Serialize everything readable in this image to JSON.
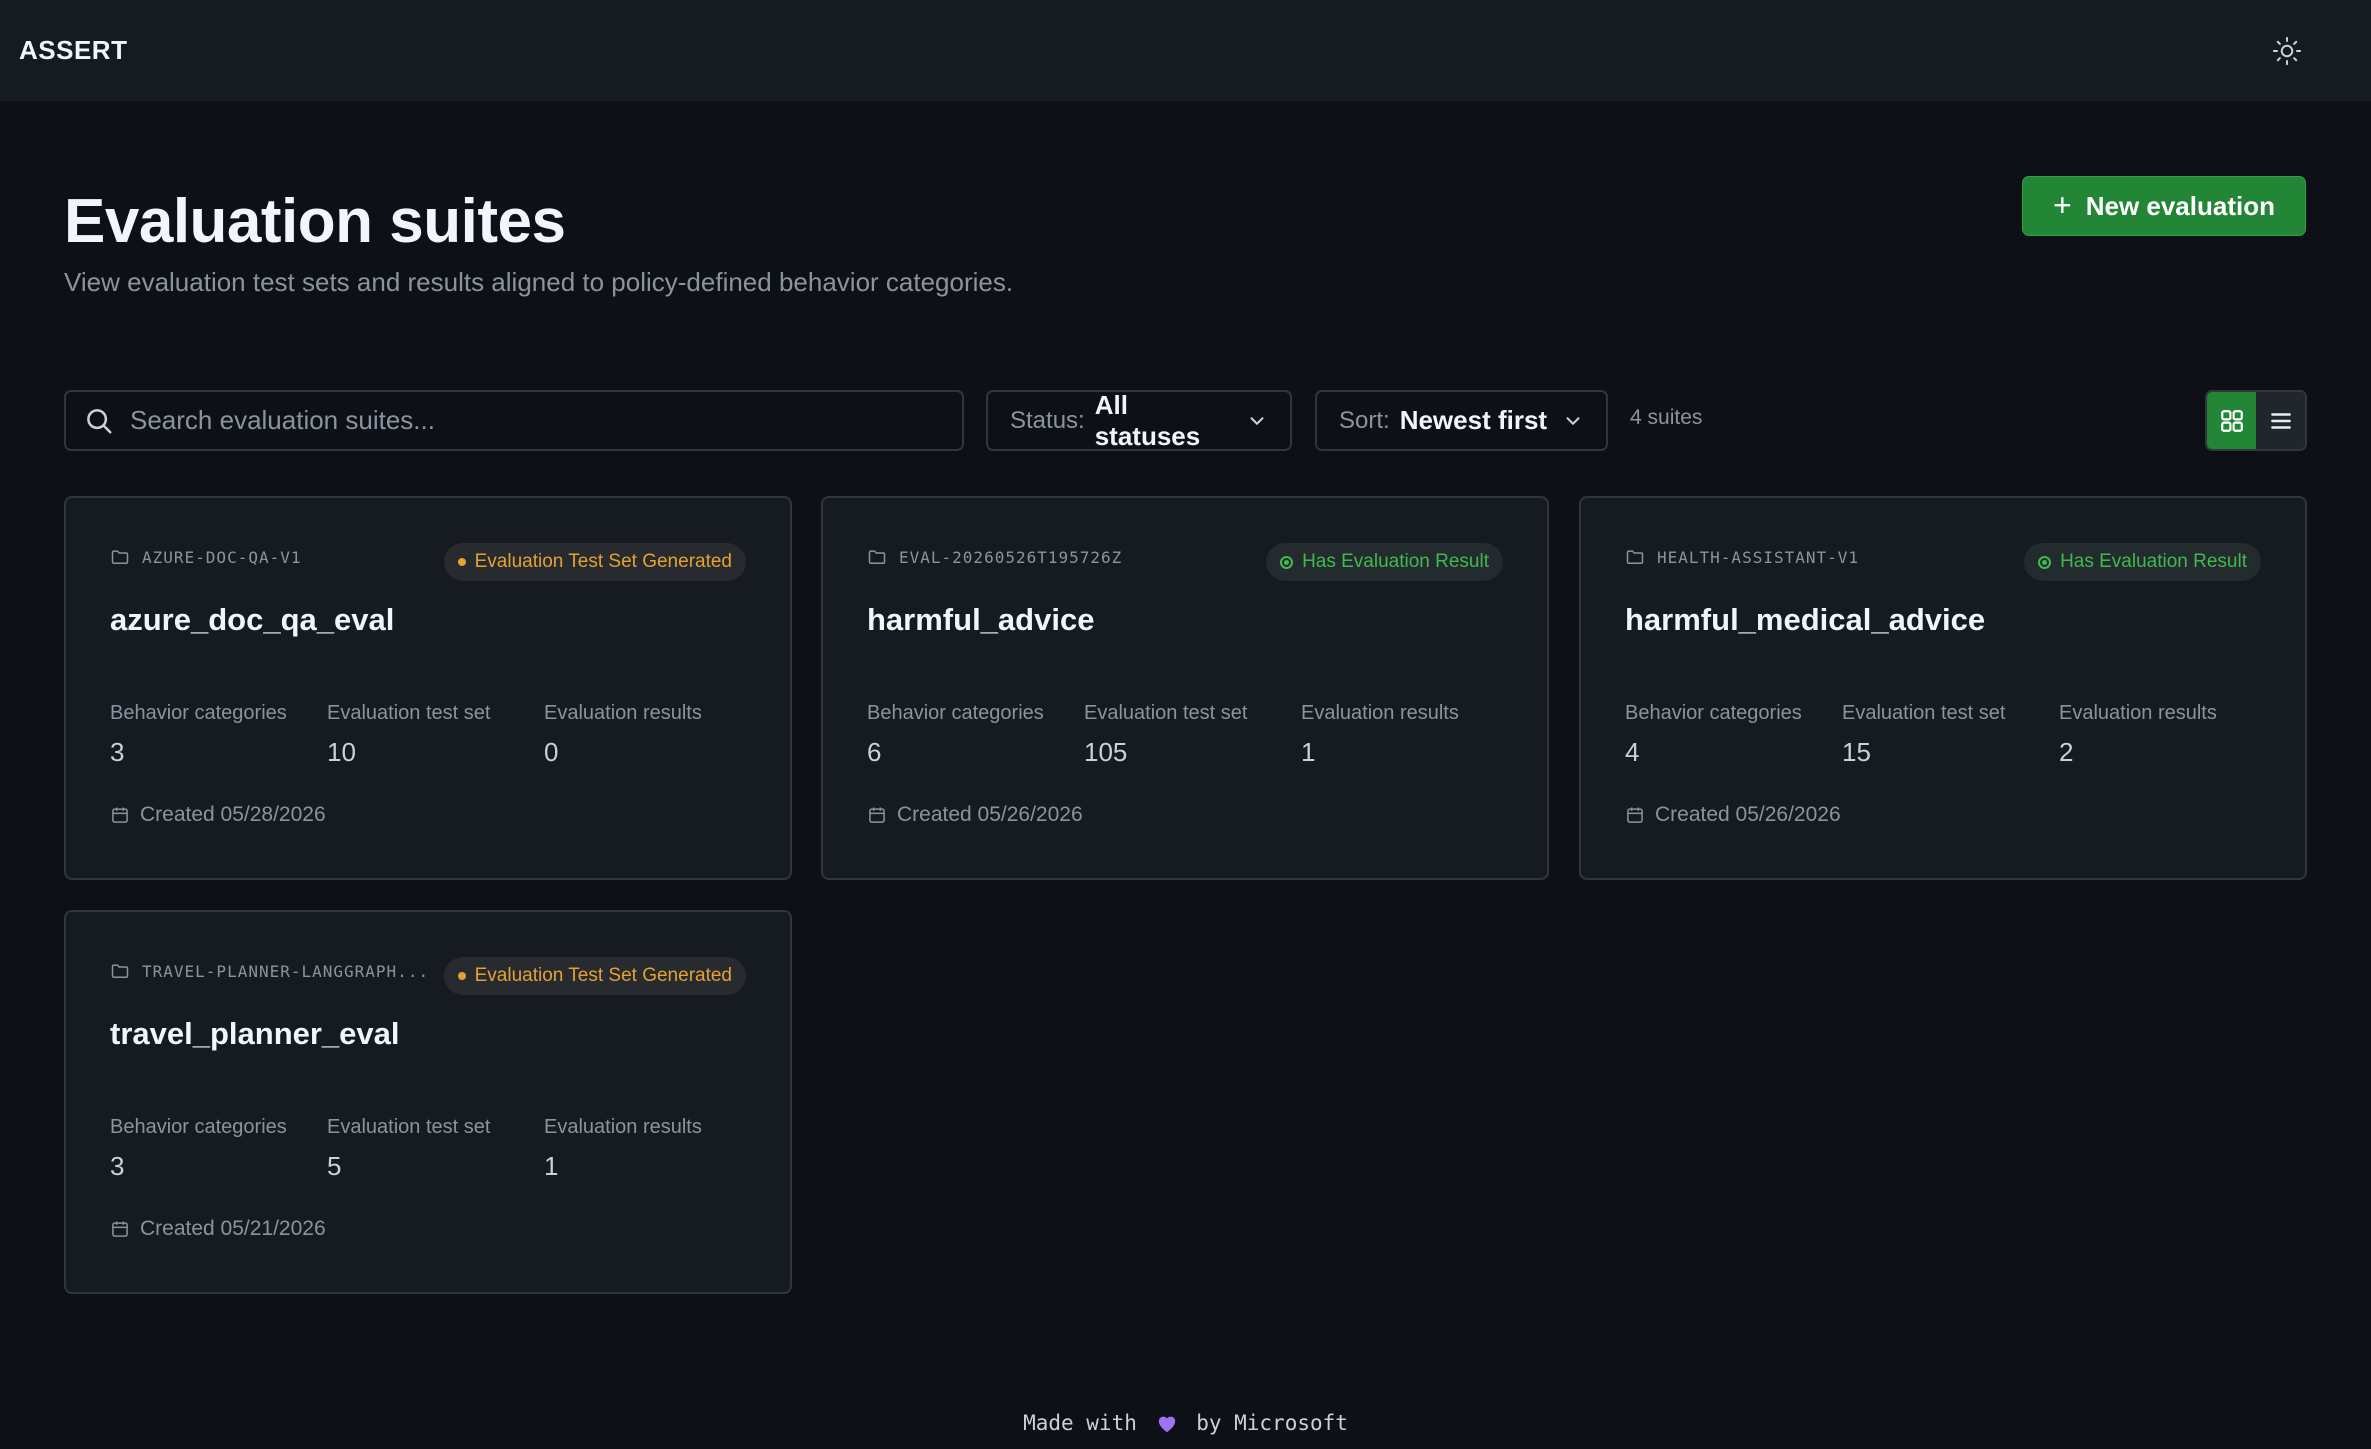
{
  "app": {
    "brand": "ASSERT"
  },
  "header": {
    "title": "Evaluation suites",
    "subtitle": "View evaluation test sets and results aligned to policy-defined behavior categories.",
    "new_button_label": "New evaluation"
  },
  "toolbar": {
    "search_placeholder": "Search evaluation suites...",
    "status_label": "Status:",
    "status_value": "All statuses",
    "sort_label": "Sort:",
    "sort_value": "Newest first",
    "count_text": "4 suites",
    "active_view": "grid"
  },
  "stat_labels": {
    "behavior": "Behavior categories",
    "test_set": "Evaluation test set",
    "results": "Evaluation results"
  },
  "cards": [
    {
      "id": "AZURE-DOC-QA-V1",
      "status": "Evaluation Test Set Generated",
      "status_kind": "generated",
      "name": "azure_doc_qa_eval",
      "behavior_categories": "3",
      "test_set": "10",
      "results": "0",
      "created": "Created 05/28/2026"
    },
    {
      "id": "EVAL-20260526T195726Z",
      "status": "Has Evaluation Result",
      "status_kind": "result",
      "name": "harmful_advice",
      "behavior_categories": "6",
      "test_set": "105",
      "results": "1",
      "created": "Created 05/26/2026"
    },
    {
      "id": "HEALTH-ASSISTANT-V1",
      "status": "Has Evaluation Result",
      "status_kind": "result",
      "name": "harmful_medical_advice",
      "behavior_categories": "4",
      "test_set": "15",
      "results": "2",
      "created": "Created 05/26/2026"
    },
    {
      "id": "TRAVEL-PLANNER-LANGGRAPH...",
      "status": "Evaluation Test Set Generated",
      "status_kind": "generated",
      "name": "travel_planner_eval",
      "behavior_categories": "3",
      "test_set": "5",
      "results": "1",
      "created": "Created 05/21/2026"
    }
  ],
  "footer": {
    "prefix": "Made with",
    "heart_icon": "purple-heart",
    "suffix": "by Microsoft"
  },
  "colors": {
    "background": "#0d1117",
    "surface": "#161b22",
    "border": "#30363d",
    "accent_green": "#238636",
    "status_generated": "#e3a232",
    "status_result": "#3fb950",
    "heart": "#a371f7"
  }
}
